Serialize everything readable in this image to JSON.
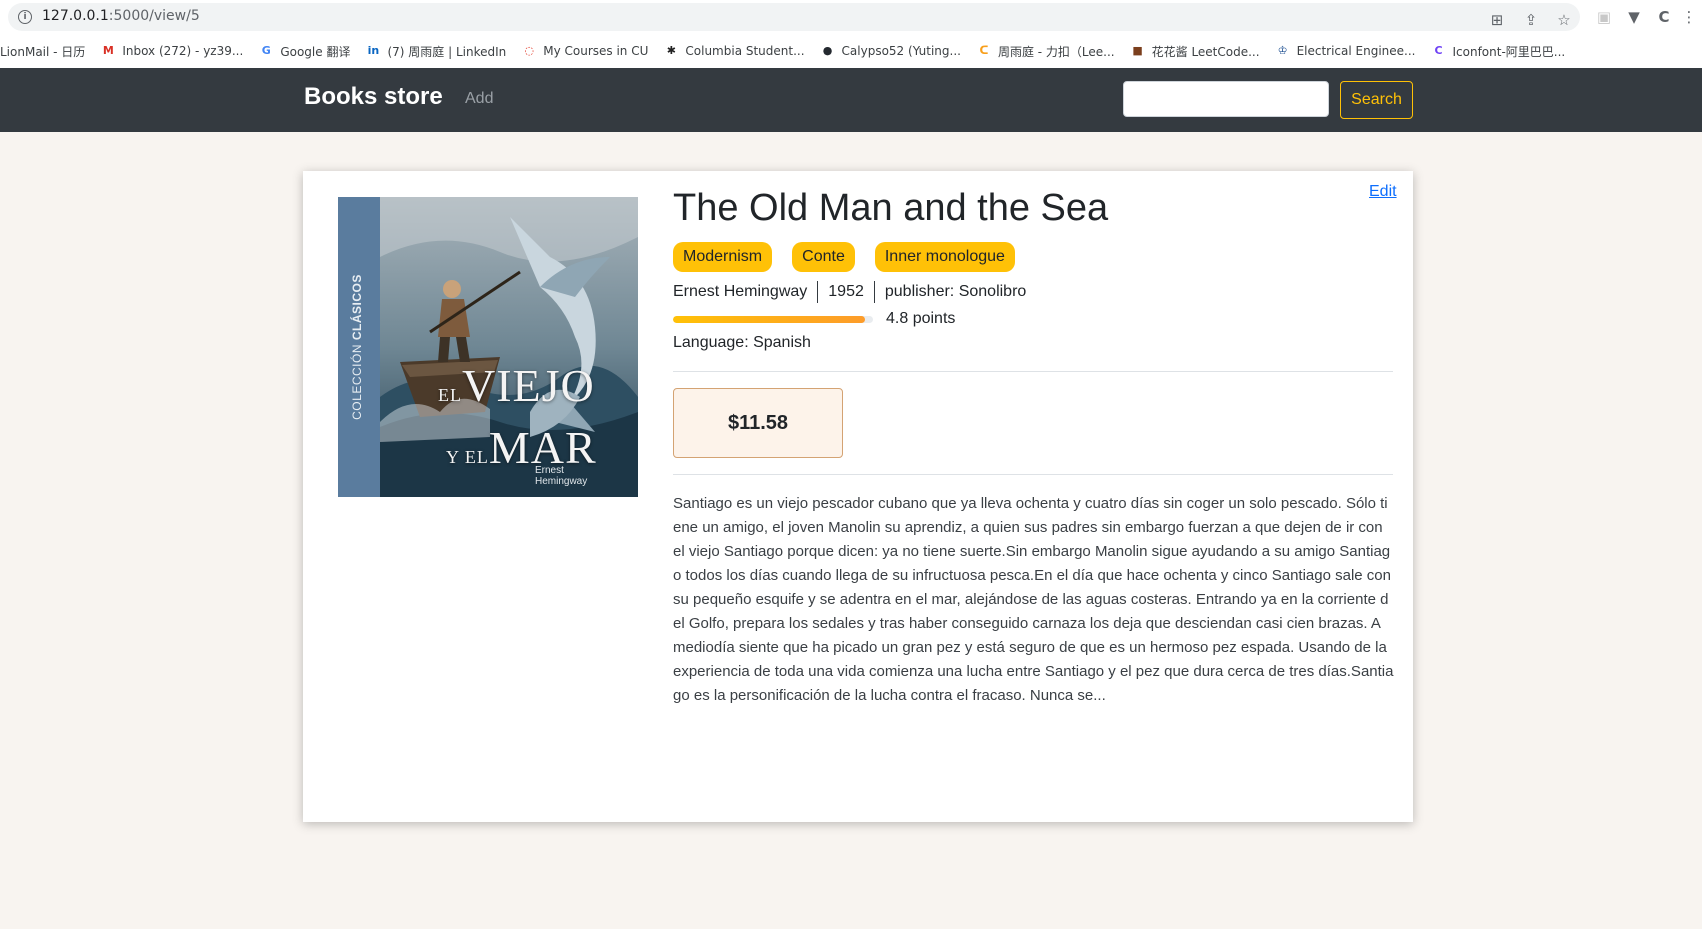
{
  "browser": {
    "url_host": "127.0.0.1",
    "url_path": ":5000/view/5",
    "bookmarks": [
      {
        "label": "LionMail - 日历",
        "icon": "none"
      },
      {
        "label": "Inbox (272) - yz39...",
        "icon": "gmail-icon",
        "color": "#d93025",
        "glyph": "M"
      },
      {
        "label": "Google 翻译",
        "icon": "translate-icon",
        "color": "#4285f4",
        "glyph": "G"
      },
      {
        "label": "(7) 周雨庭 | LinkedIn",
        "icon": "linkedin-icon",
        "color": "#0a66c2",
        "glyph": "in"
      },
      {
        "label": "My Courses in CU",
        "icon": "courses-icon",
        "color": "#e0301e",
        "glyph": "◌"
      },
      {
        "label": "Columbia Student...",
        "icon": "columbia-icon",
        "color": "#222222",
        "glyph": "✱"
      },
      {
        "label": "Calypso52 (Yuting...",
        "icon": "github-icon",
        "color": "#24292f",
        "glyph": "●"
      },
      {
        "label": "周雨庭 - 力扣（Lee...",
        "icon": "leetcode-icon",
        "color": "#f89f1b",
        "glyph": "ᑕ"
      },
      {
        "label": "花花酱 LeetCode...",
        "icon": "huahua-icon",
        "color": "#7b3f1d",
        "glyph": "■"
      },
      {
        "label": "Electrical Enginee...",
        "icon": "columbia-crown-icon",
        "color": "#1d4f91",
        "glyph": "♔"
      },
      {
        "label": "Iconfont-阿里巴巴...",
        "icon": "iconfont-icon",
        "color": "#6f42f5",
        "glyph": "C"
      }
    ]
  },
  "navbar": {
    "brand": "Books store",
    "add_label": "Add",
    "search_placeholder": "",
    "search_label": "Search"
  },
  "book": {
    "title": "The Old Man and the Sea",
    "edit_label": "Edit",
    "tags": [
      "Modernism",
      "Conte",
      "Inner monologue"
    ],
    "author": "Ernest Hemingway",
    "year": "1952",
    "publisher": "publisher: Sonolibro",
    "rating_fraction": 0.96,
    "rating_text": "4.8 points",
    "language": "Language: Spanish",
    "price": "$11.58",
    "description": "Santiago es un viejo pescador cubano que ya lleva ochenta y cuatro días sin coger un solo pescado. Sólo tiene un amigo, el joven Manolin su aprendiz, a quien sus padres sin embargo fuerzan a que dejen de ir con el viejo Santiago porque dicen: ya no tiene suerte.Sin embargo Manolin sigue ayudando a su amigo Santiago todos los días cuando llega de su infructuosa pesca.En el día que hace ochenta y cinco Santiago sale con su pequeño esquife y se adentra en el mar, alejándose de las aguas costeras. Entrando ya en la corriente del Golfo, prepara los sedales y tras haber conseguido carnaza los deja que desciendan casi cien brazas. A mediodía siente que ha picado un gran pez y está seguro de que es un hermoso pez espada. Usando de la experiencia de toda una vida comienza una lucha entre Santiago y el pez que dura cerca de tres días.Santiago es la personificación de la lucha contra el fracaso. Nunca se...",
    "cover": {
      "spine_prefix": "COLECCIÓN",
      "spine_bold": "CLÁSICOS",
      "line1_small": "EL",
      "line1_big": "VIEJO",
      "line2_small": "Y EL",
      "line2_big": "MAR",
      "author_line1": "Ernest",
      "author_line2": "Hemingway"
    }
  },
  "colors": {
    "navbar_bg": "#343a40",
    "accent": "#ffc107",
    "link": "#0d6efd",
    "price_bg": "#fdf3ea",
    "page_bg": "#f8f4f0"
  }
}
